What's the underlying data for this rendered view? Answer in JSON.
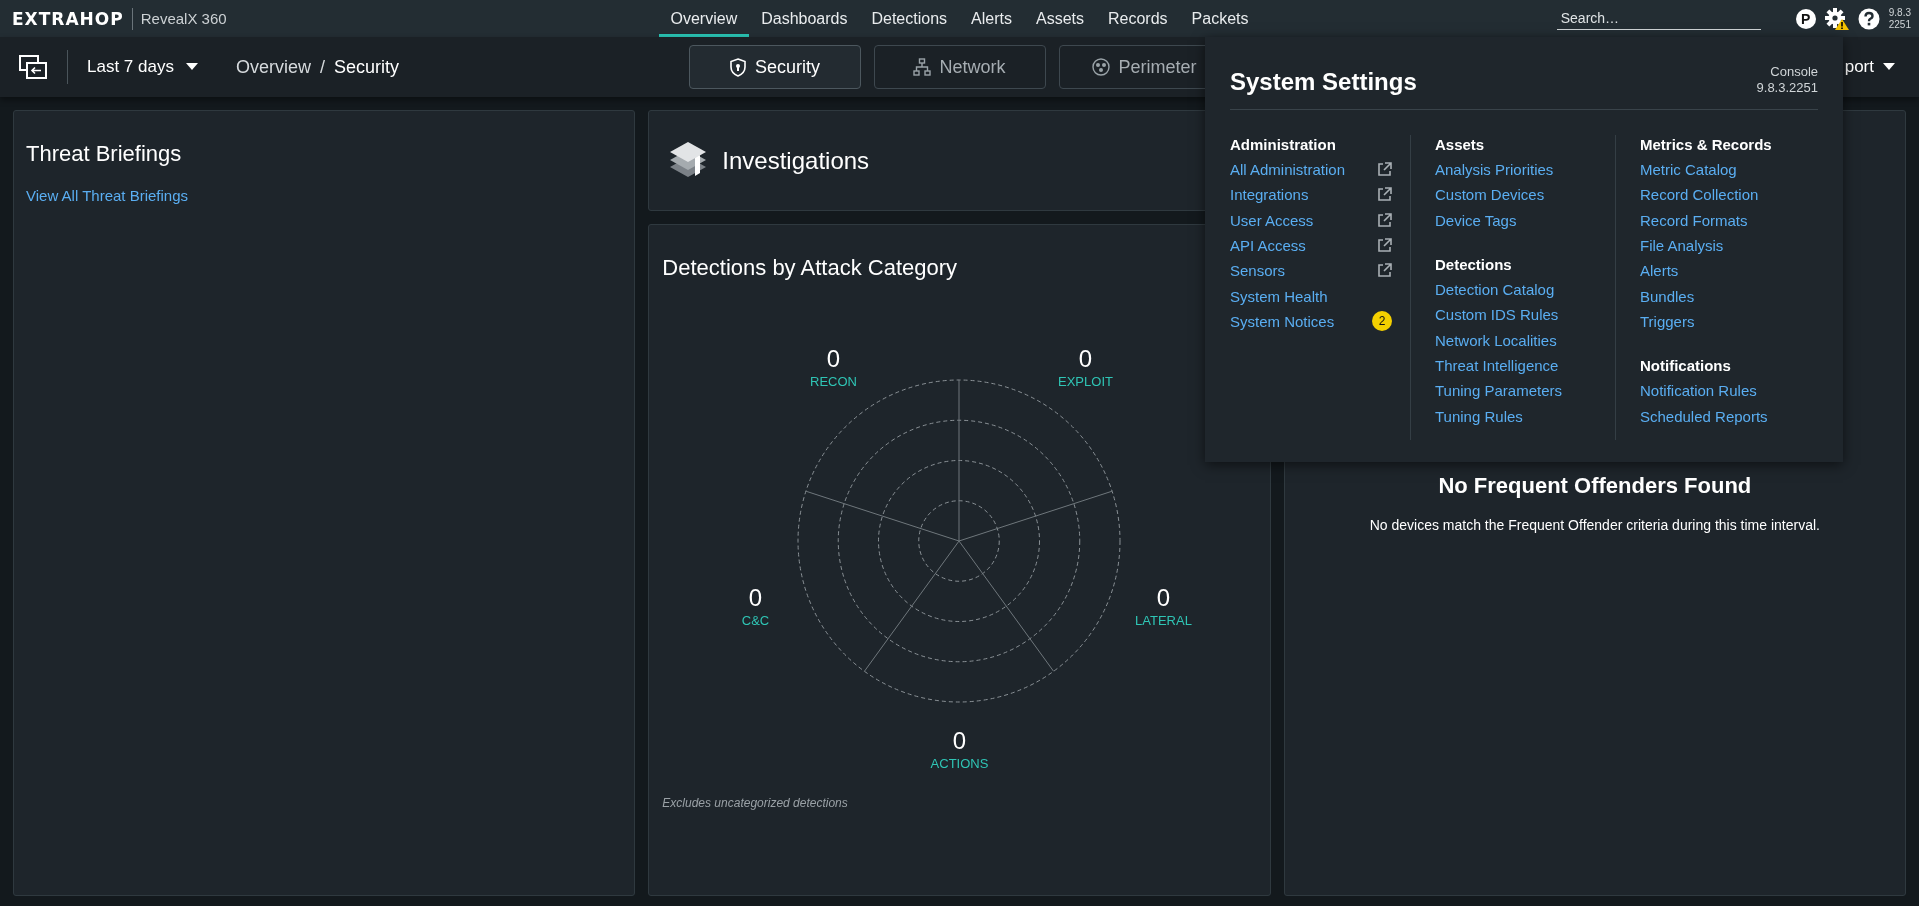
{
  "top_nav": {
    "logo": "EXTRAHOP",
    "product": "RevealX 360",
    "items": [
      {
        "label": "Overview",
        "selected": true
      },
      {
        "label": "Dashboards",
        "selected": false
      },
      {
        "label": "Detections",
        "selected": false
      },
      {
        "label": "Alerts",
        "selected": false
      },
      {
        "label": "Assets",
        "selected": false
      },
      {
        "label": "Records",
        "selected": false
      },
      {
        "label": "Packets",
        "selected": false
      }
    ],
    "search": {
      "placeholder": "Search…"
    },
    "profile_initial": "P",
    "version_lines": [
      "9.8.3",
      "2251"
    ]
  },
  "toolbar": {
    "time_range": "Last 7 days",
    "breadcrumb": [
      "Overview",
      "Security"
    ],
    "breadcrumb_separator": "/",
    "views": [
      {
        "label": "Security",
        "selected": true,
        "kind": "shield"
      },
      {
        "label": "Network",
        "selected": false,
        "kind": "tree"
      },
      {
        "label": "Perimeter",
        "selected": false,
        "kind": "perimeter"
      }
    ],
    "report_button": "port"
  },
  "threat_briefings": {
    "title": "Threat Briefings",
    "link": "View All Threat Briefings"
  },
  "investigations": {
    "title": "Investigations"
  },
  "detections_by_category": {
    "title": "Detections by Attack Category",
    "categories": [
      {
        "label": "RECON",
        "value": "0"
      },
      {
        "label": "EXPLOIT",
        "value": "0"
      },
      {
        "label": "LATERAL",
        "value": "0"
      },
      {
        "label": "ACTIONS",
        "value": "0"
      },
      {
        "label": "C&C",
        "value": "0"
      }
    ],
    "footnote": "Excludes uncategorized detections"
  },
  "frequent_offenders": {
    "title": "No Frequent Offenders Found",
    "message": "No devices match the Frequent Offender criteria during this time interval."
  },
  "settings_menu": {
    "title": "System Settings",
    "console_label": "Console",
    "version": "9.8.3.2251",
    "columns": [
      {
        "sections": [
          {
            "heading": "Administration",
            "items": [
              {
                "label": "All Administration",
                "external": true
              },
              {
                "label": "Integrations",
                "external": true
              },
              {
                "label": "User Access",
                "external": true
              },
              {
                "label": "API Access",
                "external": true
              },
              {
                "label": "Sensors",
                "external": true
              },
              {
                "label": "System Health",
                "external": false
              },
              {
                "label": "System Notices",
                "external": false,
                "badge": "2"
              }
            ]
          }
        ]
      },
      {
        "sections": [
          {
            "heading": "Assets",
            "items": [
              {
                "label": "Analysis Priorities",
                "external": false
              },
              {
                "label": "Custom Devices",
                "external": false
              },
              {
                "label": "Device Tags",
                "external": false
              }
            ]
          },
          {
            "heading": "Detections",
            "items": [
              {
                "label": "Detection Catalog",
                "external": false
              },
              {
                "label": "Custom IDS Rules",
                "external": false
              },
              {
                "label": "Network Localities",
                "external": false
              },
              {
                "label": "Threat Intelligence",
                "external": false
              },
              {
                "label": "Tuning Parameters",
                "external": false
              },
              {
                "label": "Tuning Rules",
                "external": false
              }
            ]
          }
        ]
      },
      {
        "sections": [
          {
            "heading": "Metrics & Records",
            "items": [
              {
                "label": "Metric Catalog",
                "external": false
              },
              {
                "label": "Record Collection",
                "external": false
              },
              {
                "label": "Record Formats",
                "external": false
              },
              {
                "label": "File Analysis",
                "external": false
              },
              {
                "label": "Alerts",
                "external": false
              },
              {
                "label": "Bundles",
                "external": false
              },
              {
                "label": "Triggers",
                "external": false
              }
            ]
          },
          {
            "heading": "Notifications",
            "items": [
              {
                "label": "Notification Rules",
                "external": false
              },
              {
                "label": "Scheduled Reports",
                "external": false
              }
            ]
          }
        ]
      }
    ]
  }
}
